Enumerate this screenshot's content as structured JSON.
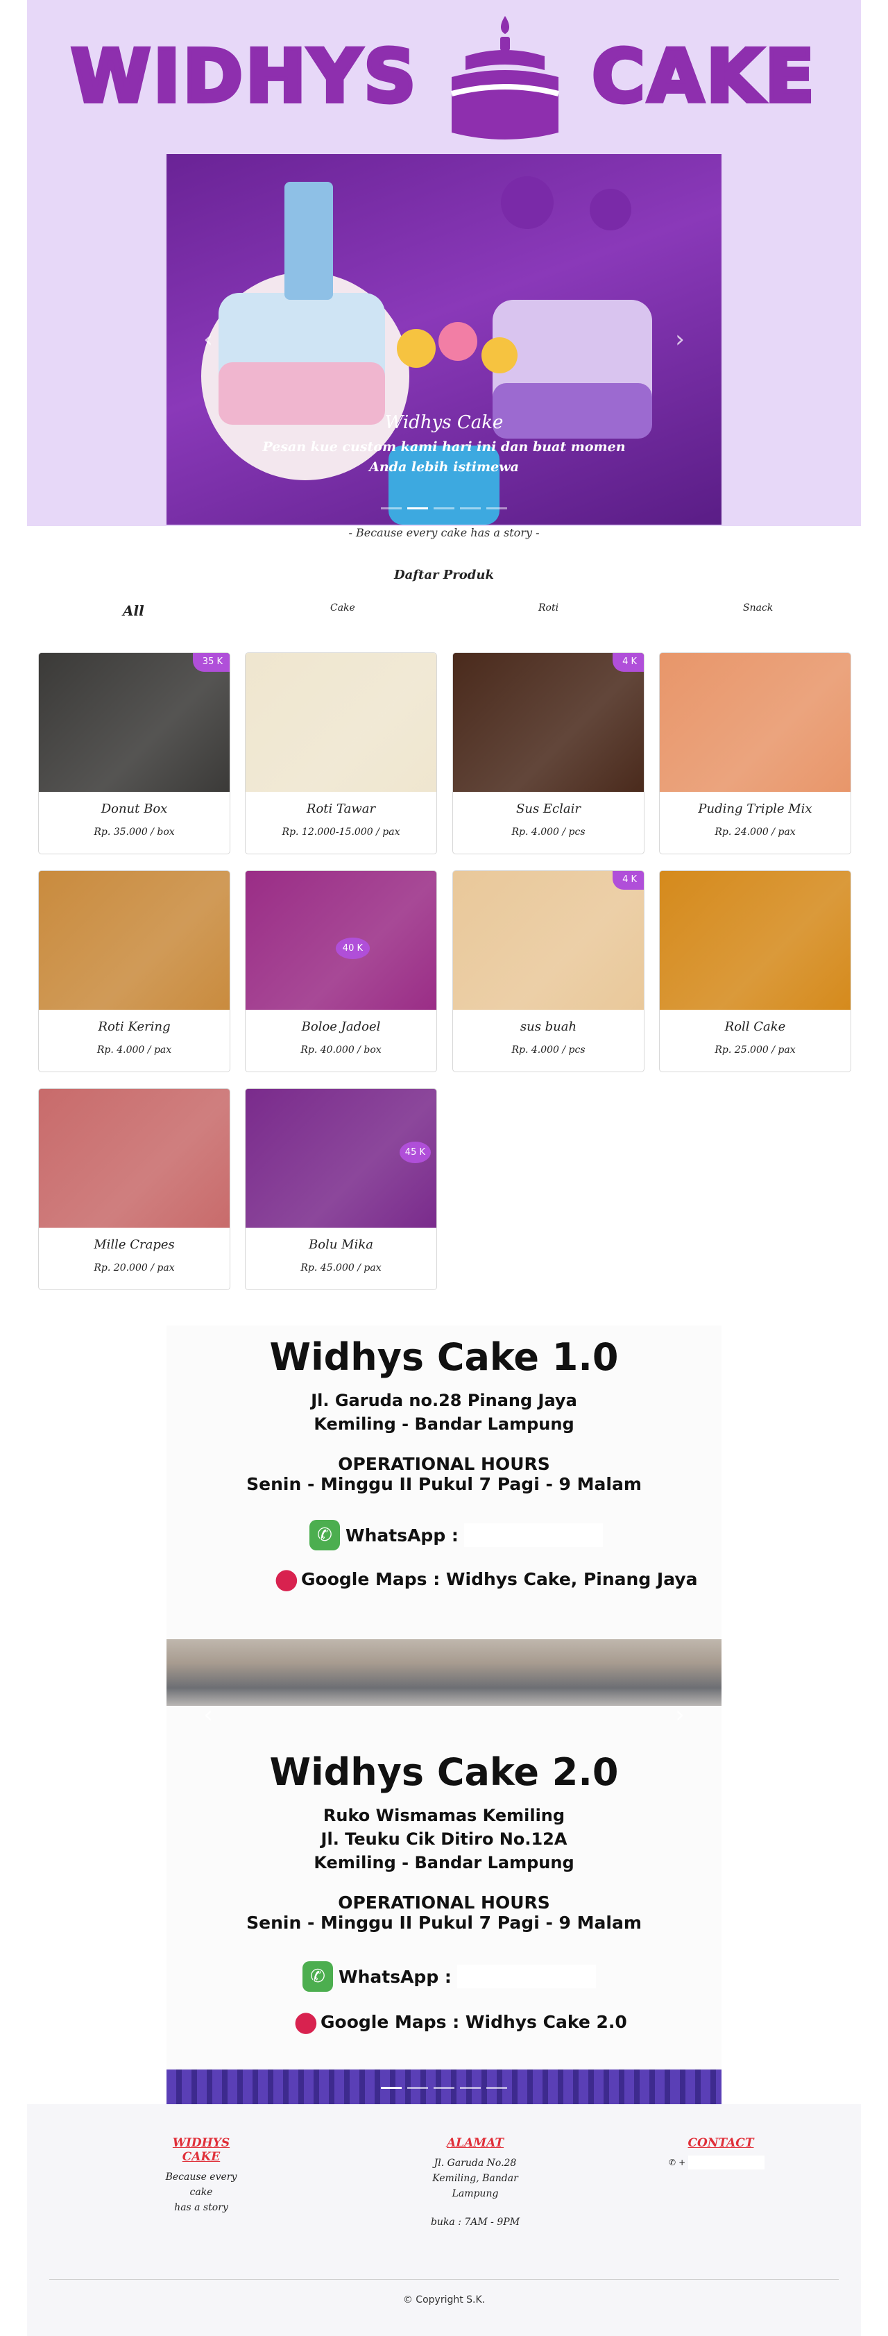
{
  "header": {
    "logo_left": "WIDHYS",
    "logo_right": "CAKE",
    "colors": {
      "background": "#e7d8f8",
      "brand": "#8e2fae"
    }
  },
  "hero_carousel": {
    "prev_icon": "chevron-left-icon",
    "next_icon": "chevron-right-icon",
    "caption_title": "Widhys Cake",
    "caption_text": "Pesan kue custom kami hari ini dan buat momen Anda lebih istimewa",
    "slide_count": 5,
    "active_slide": 1
  },
  "tagline": "- Because every cake has a story -",
  "products_section": {
    "title": "Daftar Produk",
    "filters": [
      "All",
      "Cake",
      "Roti",
      "Snack"
    ],
    "active_filter": "All",
    "items": [
      {
        "name": "Donut Box",
        "price": "Rp. 35.000 / box",
        "badge": "35 K",
        "color": "#3b3a38"
      },
      {
        "name": "Roti Tawar",
        "price": "Rp. 12.000-15.000 / pax",
        "badge": "",
        "color": "#efe6cf"
      },
      {
        "name": "Sus Eclair",
        "price": "Rp. 4.000 / pcs",
        "badge": "4 K",
        "color": "#4a2a1c"
      },
      {
        "name": "Puding Triple Mix",
        "price": "Rp. 24.000 / pax",
        "badge": "",
        "color": "#e8966a"
      },
      {
        "name": "Roti Kering",
        "price": "Rp. 4.000 / pax",
        "badge": "",
        "color": "#c98b3e"
      },
      {
        "name": "Boloe Jadoel",
        "price": "Rp. 40.000 / box",
        "badge": "40 K",
        "color": "#9a2d86"
      },
      {
        "name": "sus buah",
        "price": "Rp. 4.000 / pcs",
        "badge": "4 K",
        "color": "#e9c89a"
      },
      {
        "name": "Roll Cake",
        "price": "Rp. 25.000 / pax",
        "badge": "",
        "color": "#d58a1c"
      },
      {
        "name": "Mille Crapes",
        "price": "Rp. 20.000 / pax",
        "badge": "",
        "color": "#c86b6b"
      },
      {
        "name": "Bolu Mika",
        "price": "Rp. 45.000 / pax",
        "badge": "45 K",
        "color": "#7a2b8c"
      }
    ]
  },
  "info_carousel": {
    "store1": {
      "title": "Widhys Cake 1.0",
      "address_line1": "Jl. Garuda no.28 Pinang Jaya",
      "address_line2": "Kemiling - Bandar Lampung",
      "hours_title": "OPERATIONAL HOURS",
      "hours": "Senin - Minggu II Pukul 7 Pagi - 9 Malam",
      "whatsapp_label": "WhatsApp :",
      "maps_label": "Google Maps : Widhys Cake, Pinang Jaya"
    },
    "store2": {
      "title": "Widhys Cake 2.0",
      "address_line1": "Ruko Wismamas Kemiling",
      "address_line2": "Jl. Teuku Cik Ditiro No.12A",
      "address_line3": "Kemiling - Bandar Lampung",
      "hours_title": "OPERATIONAL HOURS",
      "hours": "Senin - Minggu II Pukul 7 Pagi - 9 Malam",
      "whatsapp_label": "WhatsApp :",
      "maps_label": "Google Maps : Widhys Cake 2.0"
    },
    "prev_icon": "chevron-left-icon",
    "next_icon": "chevron-right-icon",
    "slide_count": 5,
    "active_slide": 0
  },
  "footer": {
    "col1_title": "WIDHYS CAKE",
    "col1_line1": "Because every cake",
    "col1_line2": "has a story",
    "col2_title": "ALAMAT",
    "col2_line1": "Jl. Garuda No.28",
    "col2_line2": "Kemiling, Bandar",
    "col2_line3": "Lampung",
    "col2_hours": "buka : 7AM - 9PM",
    "col3_title": "CONTACT",
    "col3_prefix": "+",
    "copyright": "© Copyright S.K.",
    "accent": "#e0303a"
  }
}
